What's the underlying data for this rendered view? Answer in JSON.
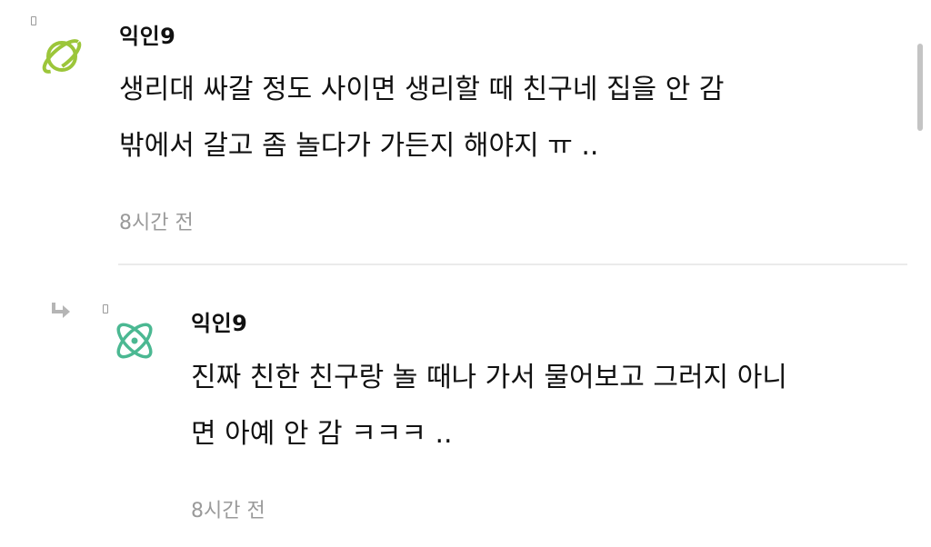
{
  "comments": [
    {
      "author": "익인9",
      "lines": [
        "생리대 싸갈 정도 사이면 생리할 때 친구네 집을 안 감",
        "밖에서 갈고 좀 놀다가 가든지 해야지 ㅠ .."
      ],
      "time": "8시간 전",
      "avatar_icon": "planet-icon",
      "avatar_color": "#9cc63a"
    }
  ],
  "reply": {
    "author": "익인9",
    "lines": [
      "진짜 친한 친구랑 놀 때나 가서 물어보고 그러지 아니",
      "면 아예 안 감 ㅋㅋㅋ .."
    ],
    "time": "8시간 전",
    "avatar_icon": "atom-icon",
    "avatar_color": "#4bb892",
    "reply_icon": "reply-arrow-icon"
  },
  "colors": {
    "text": "#111111",
    "muted": "#9a9a9a",
    "divider": "#ebebeb"
  }
}
